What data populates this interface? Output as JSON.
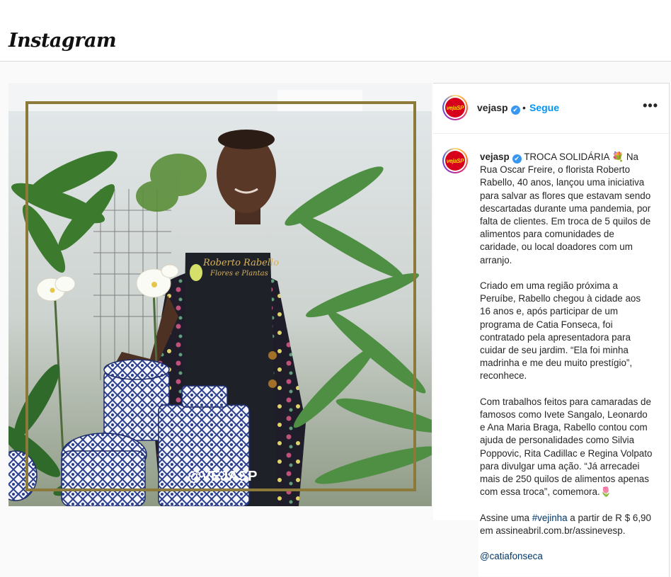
{
  "topbar": {
    "logo": "Instagram"
  },
  "post": {
    "image": {
      "watermark": "@VEJASP",
      "apron_line1": "Roberto Rabello",
      "apron_line2": "Flores e Plantas"
    },
    "header": {
      "avatar_text": "vejaSP",
      "username": "vejasp",
      "verified": "✔",
      "dot": "•",
      "follow_label": "Segue",
      "more": "•••"
    },
    "caption": {
      "username": "vejasp",
      "verified": "✔",
      "para1": "TROCA SOLIDÁRIA 💐 Na Rua Oscar Freire, o florista Roberto Rabello, 40 anos, lançou uma iniciativa para salvar as flores que estavam sendo descartadas durante uma pandemia, por falta de clientes. Em troca de 5 quilos de alimentos para comunidades de caridade, ou local doadores com um arranjo.",
      "para2": "Criado em uma região próxima a Peruíbe, Rabello chegou à cidade aos 16 anos e, após participar de um programa de Catia Fonseca, foi contratado pela apresentadora para cuidar de seu jardim. “Ela foi minha madrinha e me deu muito prestígio”, reconhece.",
      "para3": "Com trabalhos feitos para camaradas de famosos como Ivete Sangalo, Leonardo e Ana Maria Braga, Rabello contou com ajuda de personalidades como Silvia Poppovic, Rita Cadillac e Regina Volpato para divulgar uma ação. “Já arrecadei mais de 250 quilos de alimentos apenas com essa troca”, comemora.🌷",
      "para4_prefix": "Assine uma ",
      "para4_hashtag": "#vejinha",
      "para4_suffix": " a partir de R $ 6,90 em assineabril.com.br/assinevesp.",
      "mention": "@catiafonseca"
    }
  },
  "colors": {
    "accent_blue": "#0095f6",
    "verified_blue": "#3897f0",
    "frame_gold": "#8c7a3a",
    "brand_red": "#d6001c"
  }
}
